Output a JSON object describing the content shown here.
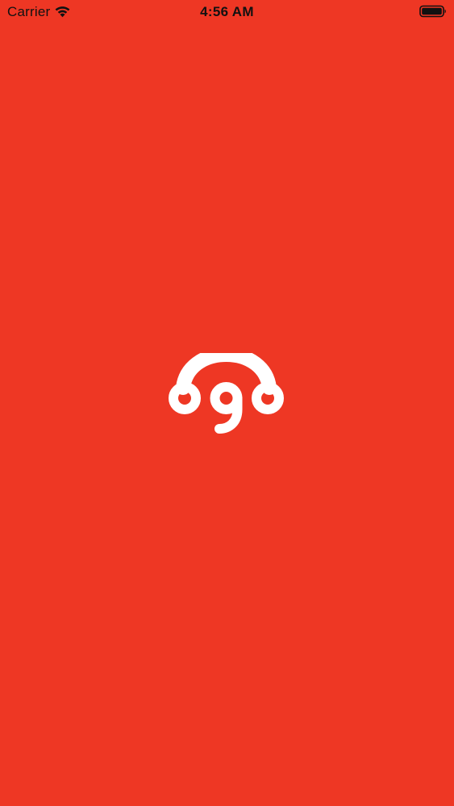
{
  "status_bar": {
    "carrier": "Carrier",
    "time": "4:56 AM",
    "wifi_icon": "wifi-icon",
    "battery_icon": "battery-icon"
  },
  "splash": {
    "logo_text": "ogo",
    "logo_icon": "ogo-logo-icon"
  },
  "colors": {
    "background": "#ee3724",
    "logo": "#ffffff",
    "status_text": "#111111"
  }
}
